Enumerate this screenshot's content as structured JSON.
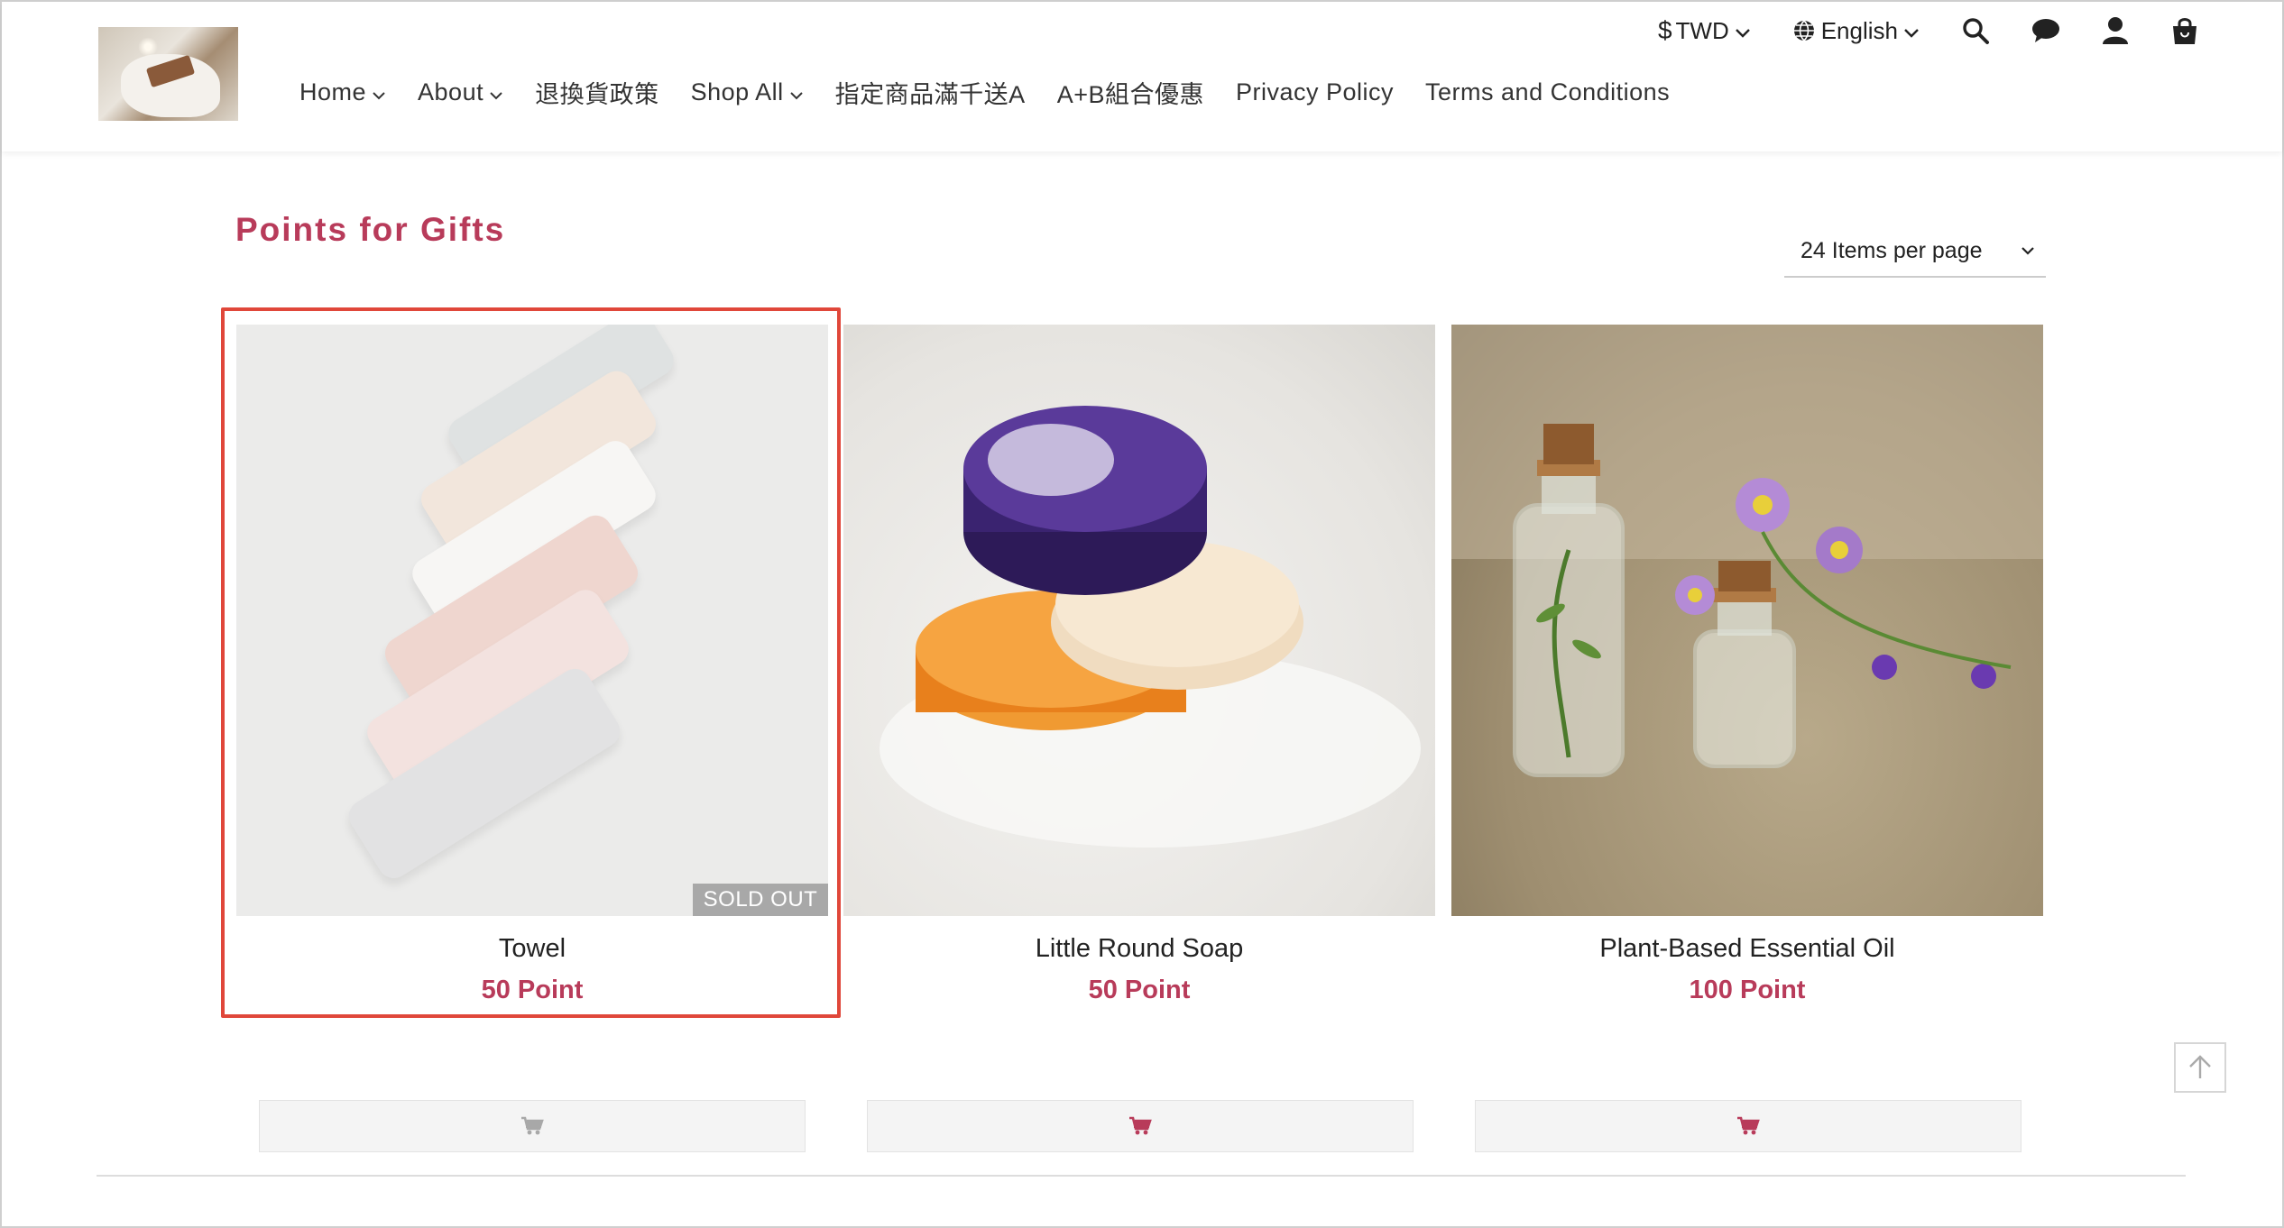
{
  "header": {
    "currency": "TWD",
    "language": "English",
    "icons": [
      "search-icon",
      "chat-icon",
      "user-icon",
      "shopping-bag-icon"
    ],
    "nav": [
      {
        "label": "Home",
        "has_dropdown": true
      },
      {
        "label": "About",
        "has_dropdown": true
      },
      {
        "label": "退換貨政策",
        "has_dropdown": false
      },
      {
        "label": "Shop All",
        "has_dropdown": true
      },
      {
        "label": "指定商品滿千送A",
        "has_dropdown": false
      },
      {
        "label": "A+B組合優惠",
        "has_dropdown": false
      },
      {
        "label": "Privacy Policy",
        "has_dropdown": false
      },
      {
        "label": "Terms and Conditions",
        "has_dropdown": false
      }
    ]
  },
  "main": {
    "title": "Points for Gifts",
    "per_page": "24 Items per page",
    "products": [
      {
        "name": "Towel",
        "price": "50 Point",
        "badge": "SOLD OUT",
        "highlighted": true,
        "cart_enabled": false
      },
      {
        "name": "Little Round Soap",
        "price": "50 Point",
        "badge": "",
        "highlighted": false,
        "cart_enabled": true
      },
      {
        "name": "Plant-Based Essential Oil",
        "price": "100 Point",
        "badge": "",
        "highlighted": false,
        "cart_enabled": true
      }
    ]
  },
  "colors": {
    "accent": "#b83b5a",
    "highlight_border": "#e0473a",
    "cart_disabled": "#a8a8a8"
  }
}
